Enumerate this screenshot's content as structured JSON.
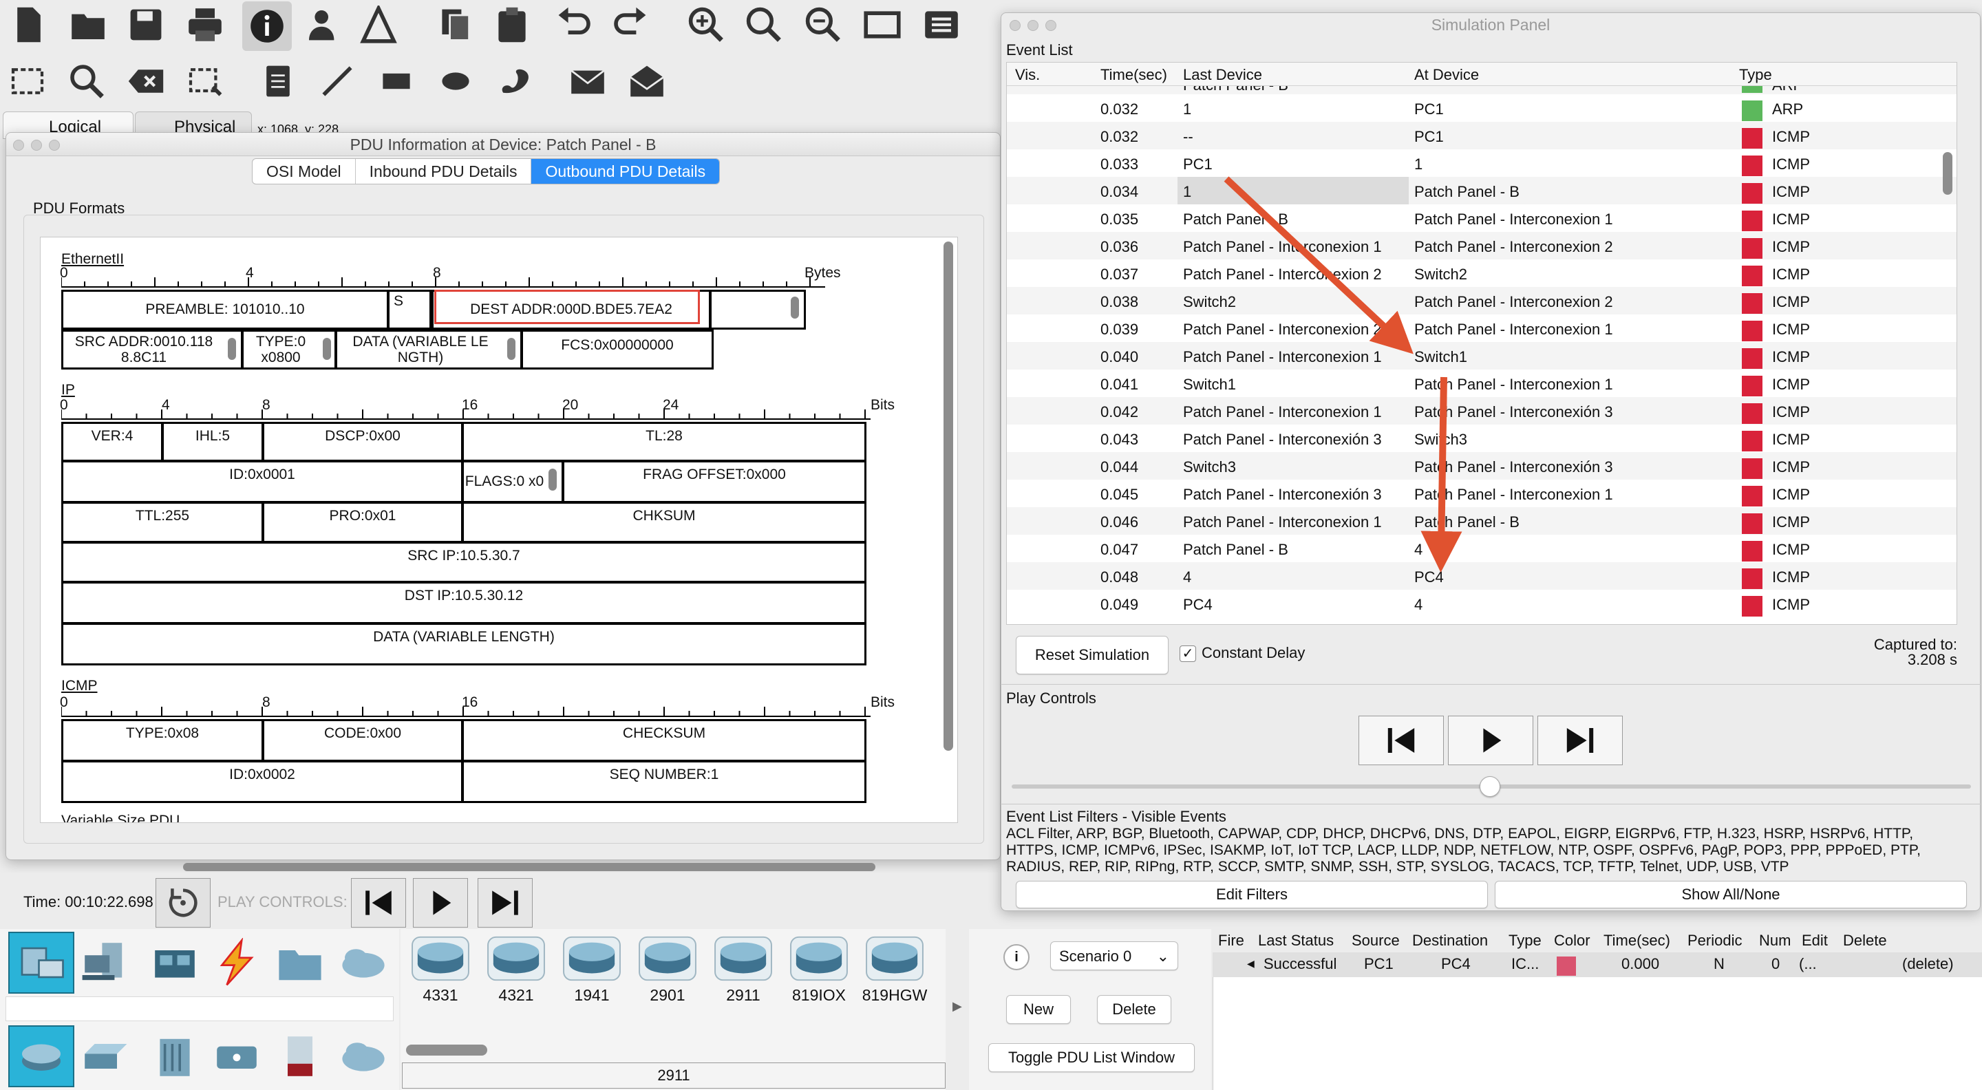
{
  "main": {
    "tabs": [
      "Logical",
      "Physical"
    ],
    "coords": "x: 1068, y: 228",
    "time_label": "Time: 00:10:22.698",
    "play_controls_label": "PLAY CONTROLS:",
    "device_models": [
      "4331",
      "4321",
      "1941",
      "2901",
      "2911",
      "819IOX",
      "819HGW"
    ],
    "selected_model": "2911"
  },
  "pdu_window": {
    "title": "PDU Information at Device: Patch Panel - B",
    "tabs": [
      "OSI Model",
      "Inbound PDU Details",
      "Outbound PDU Details"
    ],
    "active_tab": "Outbound PDU Details",
    "formats_label": "PDU Formats",
    "ethernet": {
      "name": "EthernetII",
      "ruler": [
        "0",
        "4",
        "8",
        "Bytes"
      ],
      "preamble": "PREAMBLE: 101010..10",
      "sfd": "S",
      "dest": "DEST ADDR:000D.BDE5.7EA2",
      "src": "SRC ADDR:0010.118 8.8C11",
      "type": "TYPE:0 x0800",
      "data": "DATA (VARIABLE LE NGTH)",
      "fcs": "FCS:0x00000000"
    },
    "ip": {
      "name": "IP",
      "ruler": [
        "0",
        "4",
        "8",
        "16",
        "20",
        "24",
        "Bits"
      ],
      "ver": "VER:4",
      "ihl": "IHL:5",
      "dscp": "DSCP:0x00",
      "tl": "TL:28",
      "id": "ID:0x0001",
      "flags": "FLAGS:0 x0",
      "frag": "FRAG OFFSET:0x000",
      "ttl": "TTL:255",
      "pro": "PRO:0x01",
      "chksum": "CHKSUM",
      "src": "SRC IP:10.5.30.7",
      "dst": "DST IP:10.5.30.12",
      "data": "DATA (VARIABLE LENGTH)"
    },
    "icmp": {
      "name": "ICMP",
      "ruler": [
        "0",
        "8",
        "16",
        "Bits"
      ],
      "type": "TYPE:0x08",
      "code": "CODE:0x00",
      "checksum": "CHECKSUM",
      "id": "ID:0x0002",
      "seq": "SEQ NUMBER:1"
    },
    "footer_label": "Variable Size PDU"
  },
  "sim_panel": {
    "title": "Simulation Panel",
    "event_list_label": "Event List",
    "columns": [
      "Vis.",
      "Time(sec)",
      "Last Device",
      "At Device",
      "Type"
    ],
    "partial_row": {
      "last": "Patch Panel - B",
      "type": "ARP"
    },
    "events": [
      {
        "time": "0.032",
        "last": "1",
        "at": "PC1",
        "type": "ARP",
        "color": "#5cb85c"
      },
      {
        "time": "0.032",
        "last": "--",
        "at": "PC1",
        "type": "ICMP",
        "color": "#d9223a"
      },
      {
        "time": "0.033",
        "last": "PC1",
        "at": "1",
        "type": "ICMP",
        "color": "#d9223a"
      },
      {
        "time": "0.034",
        "last": "1",
        "at": "Patch Panel - B",
        "type": "ICMP",
        "color": "#d9223a"
      },
      {
        "time": "0.035",
        "last": "Patch Panel - B",
        "at": "Patch Panel - Interconexion 1",
        "type": "ICMP",
        "color": "#d9223a"
      },
      {
        "time": "0.036",
        "last": "Patch Panel - Interconexion 1",
        "at": "Patch Panel - Interconexion 2",
        "type": "ICMP",
        "color": "#d9223a"
      },
      {
        "time": "0.037",
        "last": "Patch Panel - Interconexion 2",
        "at": "Switch2",
        "type": "ICMP",
        "color": "#d9223a"
      },
      {
        "time": "0.038",
        "last": "Switch2",
        "at": "Patch Panel - Interconexion 2",
        "type": "ICMP",
        "color": "#d9223a"
      },
      {
        "time": "0.039",
        "last": "Patch Panel - Interconexion 2",
        "at": "Patch Panel - Interconexion 1",
        "type": "ICMP",
        "color": "#d9223a"
      },
      {
        "time": "0.040",
        "last": "Patch Panel - Interconexion 1",
        "at": "Switch1",
        "type": "ICMP",
        "color": "#d9223a"
      },
      {
        "time": "0.041",
        "last": "Switch1",
        "at": "Patch Panel - Interconexion 1",
        "type": "ICMP",
        "color": "#d9223a"
      },
      {
        "time": "0.042",
        "last": "Patch Panel - Interconexion 1",
        "at": "Patch Panel - Interconexión 3",
        "type": "ICMP",
        "color": "#d9223a"
      },
      {
        "time": "0.043",
        "last": "Patch Panel - Interconexión 3",
        "at": "Switch3",
        "type": "ICMP",
        "color": "#d9223a"
      },
      {
        "time": "0.044",
        "last": "Switch3",
        "at": "Patch Panel - Interconexión 3",
        "type": "ICMP",
        "color": "#d9223a"
      },
      {
        "time": "0.045",
        "last": "Patch Panel - Interconexión 3",
        "at": "Patch Panel - Interconexion 1",
        "type": "ICMP",
        "color": "#d9223a"
      },
      {
        "time": "0.046",
        "last": "Patch Panel - Interconexion 1",
        "at": "Patch Panel - B",
        "type": "ICMP",
        "color": "#d9223a"
      },
      {
        "time": "0.047",
        "last": "Patch Panel - B",
        "at": "4",
        "type": "ICMP",
        "color": "#d9223a"
      },
      {
        "time": "0.048",
        "last": "4",
        "at": "PC4",
        "type": "ICMP",
        "color": "#d9223a"
      },
      {
        "time": "0.049",
        "last": "PC4",
        "at": "4",
        "type": "ICMP",
        "color": "#d9223a"
      }
    ],
    "reset_label": "Reset Simulation",
    "constant_delay_label": "Constant Delay",
    "constant_delay_checked": true,
    "captured_label": "Captured to:",
    "captured_value": "3.208 s",
    "play_controls_label": "Play Controls",
    "filters_label": "Event List Filters - Visible Events",
    "filters_text_1": "ACL Filter, ARP, BGP, Bluetooth, CAPWAP, CDP, DHCP, DHCPv6, DNS, DTP, EAPOL, EIGRP, EIGRPv6, FTP, H.323, HSRP, HSRPv6, HTTP,",
    "filters_text_2": "HTTPS, ICMP, ICMPv6, IPSec, ISAKMP, IoT, IoT TCP, LACP, LLDP, NDP, NETFLOW, NTP, OSPF, OSPFv6, PAgP, POP3, PPP, PPPoED, PTP,",
    "filters_text_3": "RADIUS, REP, RIP, RIPng, RTP, SCCP, SMTP, SNMP, SSH, STP, SYSLOG, TACACS, TCP, TFTP, Telnet, UDP, USB, VTP",
    "edit_filters_label": "Edit Filters",
    "show_all_label": "Show All/None"
  },
  "scenario": {
    "selected": "Scenario 0",
    "new_label": "New",
    "delete_label": "Delete",
    "toggle_label": "Toggle PDU List Window",
    "columns": [
      "Fire",
      "Last Status",
      "Source",
      "Destination",
      "Type",
      "Color",
      "Time(sec)",
      "Periodic",
      "Num",
      "Edit",
      "Delete"
    ],
    "row": {
      "status": "Successful",
      "source": "PC1",
      "destination": "PC4",
      "type": "IC...",
      "color": "#d9536f",
      "time": "0.000",
      "periodic": "N",
      "num": "0",
      "edit": "(...",
      "delete": "(delete)"
    }
  }
}
